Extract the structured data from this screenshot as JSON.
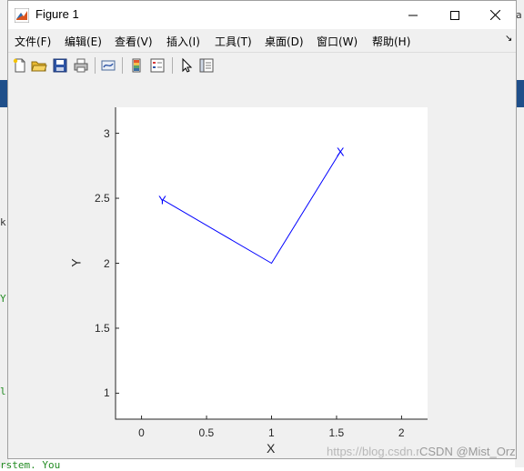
{
  "window": {
    "title": "Figure 1",
    "minimize_glyph": "—",
    "maximize_glyph": "☐",
    "close_glyph": "✕"
  },
  "menu": {
    "items": [
      "文件(F)",
      "编辑(E)",
      "查看(V)",
      "插入(I)",
      "工具(T)",
      "桌面(D)",
      "窗口(W)",
      "帮助(H)"
    ],
    "overflow_glyph": "↘"
  },
  "toolbar": {
    "icons": [
      "new-figure-icon",
      "open-file-icon",
      "save-icon",
      "print-icon",
      "link-plot-icon",
      "insert-colorbar-icon",
      "insert-legend-icon",
      "pointer-icon",
      "property-inspector-icon"
    ]
  },
  "chart_data": {
    "type": "line",
    "xlabel": "X",
    "ylabel": "Y",
    "xlim": [
      -0.2,
      2.2
    ],
    "ylim": [
      0.8,
      3.2
    ],
    "xticks": [
      "0",
      "0.5",
      "1",
      "1.5",
      "2"
    ],
    "yticks": [
      "1",
      "1.5",
      "2",
      "2.5",
      "3"
    ],
    "series": [
      {
        "x": [
          0.16,
          1.0,
          1.53
        ],
        "y": [
          2.49,
          2.0,
          2.86
        ],
        "color": "#0000ff"
      }
    ],
    "annotations": [
      {
        "text": "Y",
        "x": 0.16,
        "y": 2.49
      },
      {
        "text": "X",
        "x": 1.53,
        "y": 2.86
      }
    ]
  },
  "watermark": "https://blog.csdn.net",
  "watermark2": "CSDN @Mist_Orz",
  "background": {
    "fragment_1": "Y",
    "fragment_2": "l",
    "fragment_3": "rstem. You",
    "fragment_4": "k",
    "fragment_5": "a"
  },
  "colors": {
    "line": "#0000ff",
    "tick_text": "#262626"
  }
}
